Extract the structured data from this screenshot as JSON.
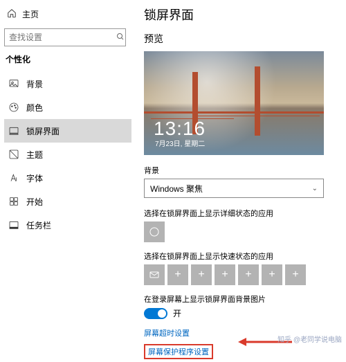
{
  "left": {
    "home": "主页",
    "search_placeholder": "查找设置",
    "section": "个性化",
    "items": [
      {
        "icon": "image",
        "label": "背景"
      },
      {
        "icon": "palette",
        "label": "颜色"
      },
      {
        "icon": "lock",
        "label": "锁屏界面"
      },
      {
        "icon": "theme",
        "label": "主题"
      },
      {
        "icon": "font",
        "label": "字体"
      },
      {
        "icon": "start",
        "label": "开始"
      },
      {
        "icon": "taskbar",
        "label": "任务栏"
      }
    ],
    "active_index": 2
  },
  "right": {
    "title": "锁屏界面",
    "preview_heading": "预览",
    "clock_time": "13:16",
    "clock_date": "7月23日, 星期二",
    "background_heading": "背景",
    "background_selected": "Windows 聚焦",
    "detail_app_heading": "选择在锁屏界面上显示详细状态的应用",
    "quick_app_heading": "选择在锁屏界面上显示快速状态的应用",
    "signin_bg_heading": "在登录屏幕上显示锁屏界面背景图片",
    "toggle_label": "开",
    "link_timeout": "屏幕超时设置",
    "link_saver": "屏幕保护程序设置"
  },
  "watermark": "知乎 @老同学说电脑"
}
